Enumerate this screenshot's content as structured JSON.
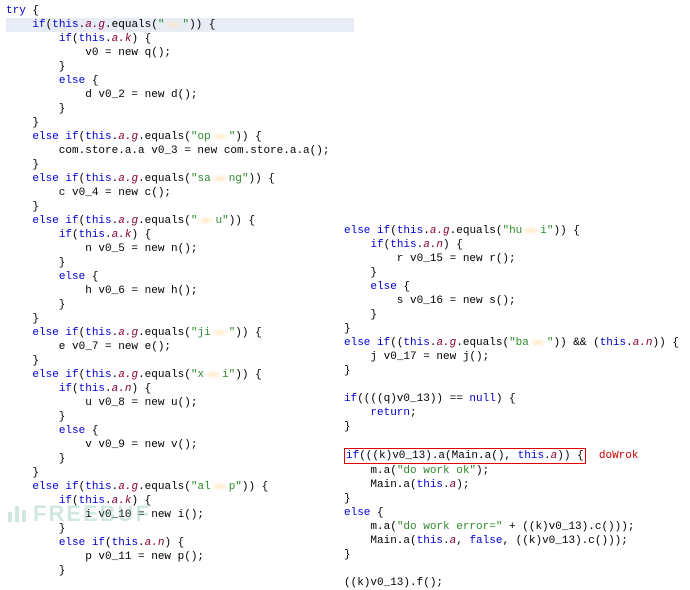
{
  "left": {
    "l01a": "try {",
    "l01b": "    if(this.",
    "l01c": ".equals(",
    "l01d": "\"",
    "l01e": "\"",
    "l01f": ")) {",
    "l02": "        if(this.",
    "l02f": ") {",
    "l03": "            v0 = new q();",
    "l04": "        }",
    "l05": "        else {",
    "l06": "            d v0_2 = new d();",
    "l07": "        }",
    "l08": "    }",
    "l09a": "    else if(this.",
    "l09b": ".equals(",
    "l09c": "\"op",
    "l09d": "\"",
    "l09e": ")) {",
    "l10": "        com.store.a.a v0_3 = new com.store.a.a();",
    "l11": "    }",
    "l12a": "    else if(this.",
    "l12b": ".equals(",
    "l12c": "\"sa",
    "l12d": "ng\"",
    "l12e": ")) {",
    "l13": "        c v0_4 = new c();",
    "l14": "    }",
    "l15a": "    else if(this.",
    "l15b": ".equals(",
    "l15c": "\"",
    "l15d": "\"",
    "l15e": ")) {",
    "l16": "        if(this.",
    "l16f": ") {",
    "l17": "            n v0_5 = new n();",
    "l18": "        }",
    "l19": "        else {",
    "l20": "            h v0_6 = new h();",
    "l21": "        }",
    "l22": "    }",
    "l23a": "    else if(this.",
    "l23b": ".equals(",
    "l23c": "\"ji",
    "l23d": "\"",
    "l23e": ")) {",
    "l24": "        e v0_7 = new e();",
    "l25": "    }",
    "l26a": "    else if(this.",
    "l26b": ".equals(",
    "l26c": "\"x",
    "l26d": "i\"",
    "l26e": ")) {",
    "l27": "        if(this.",
    "l27f": ") {",
    "l28": "            u v0_8 = new u();",
    "l29": "        }",
    "l30": "        else {",
    "l31": "            v v0_9 = new v();",
    "l32": "        }",
    "l33": "    }",
    "l34a": "    else if(this.",
    "l34b": ".equals(",
    "l34c": "\"al",
    "l34d": "p\"",
    "l34e": ")) {",
    "l35": "        if(this.",
    "l35f": ") {",
    "l36": "            i v0_10 = new i();",
    "l37": "        }",
    "l38": "        else if(this.",
    "l38f": ") {",
    "l39": "            p v0_11 = new p();",
    "l40": "        }",
    "field_ag": "a.g",
    "field_ak": "a.k",
    "field_an": "a.n"
  },
  "right": {
    "r00": ")))",
    "r01a": "else if(this.",
    "r01b": ".equals(",
    "r01c": "\"hu",
    "r01d": "i\"",
    "r01e": ")) {",
    "r02": "    if(this.",
    "r02f": ") {",
    "r03": "        r v0_15 = new r();",
    "r04": "    }",
    "r05": "    else {",
    "r06": "        s v0_16 = new s();",
    "r07": "    }",
    "r08": "}",
    "r09a": "else if((this.",
    "r09b": ".equals(",
    "r09c": "\"ba",
    "r09d": "\"",
    "r09e": ")) && (this.",
    "r09f": ")) {",
    "r10": "    j v0_17 = new j();",
    "r11": "}",
    "r12": "",
    "r13": "if((((q)v0_13)) == null) {",
    "r14": "    return;",
    "r15": "}",
    "r16": "",
    "r17a": "if(((k)v0_13).a(Main.a(), this.",
    "r17b": ")) {",
    "r18a": "    m.a(",
    "r18b": "\"do work ok\"",
    "r18c": ");",
    "r19": "    Main.a(this.",
    "r19b": ");",
    "r20": "}",
    "r21": "else {",
    "r22a": "    m.a(",
    "r22b": "\"do work error=\"",
    "r22c": " + ((k)v0_13).c()));",
    "r23": "    Main.a(this.",
    "r23b": ", false, ((k)v0_13).c()));",
    "r24": "}",
    "r25": "",
    "r26": "((k)v0_13).f();",
    "note": "doWrok",
    "field_ag": "a.g",
    "field_an": "a.n",
    "field_a": "a"
  },
  "watermark": "FREEBUF"
}
